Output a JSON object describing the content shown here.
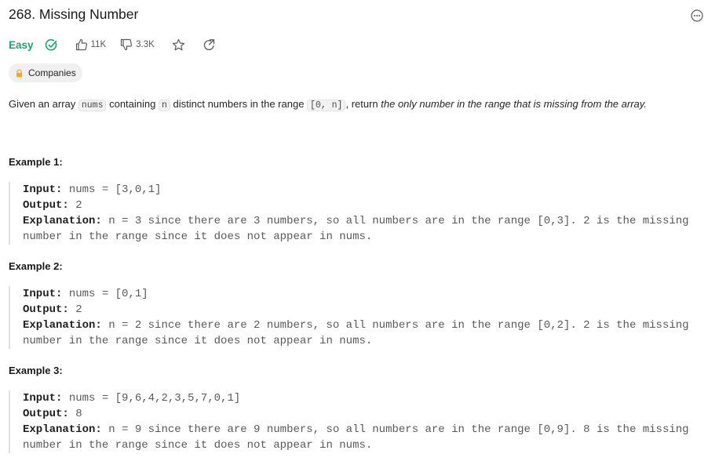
{
  "problem": {
    "title": "268. Missing Number",
    "difficulty": "Easy",
    "likes": "11K",
    "dislikes": "3.3K",
    "companies_label": "Companies"
  },
  "description": {
    "p1": "Given an array ",
    "c1": "nums",
    "p2": " containing ",
    "c2": "n",
    "p3": " distinct numbers in the range ",
    "c3": "[0, n]",
    "p4": ", return ",
    "em": "the only number in the range that is missing from the array."
  },
  "examples": [
    {
      "heading": "Example 1:",
      "input_label": "Input:",
      "input": " nums = [3,0,1]",
      "output_label": "Output:",
      "output": " 2",
      "explanation_label": "Explanation:",
      "explanation_1": " n = 3 since there are 3 numbers, so all numbers are in the range [0,3]. 2 is the missing",
      "explanation_2": "number in the range since it does not appear in nums."
    },
    {
      "heading": "Example 2:",
      "input_label": "Input:",
      "input": " nums = [0,1]",
      "output_label": "Output:",
      "output": " 2",
      "explanation_label": "Explanation:",
      "explanation_1": " n = 2 since there are 2 numbers, so all numbers are in the range [0,2]. 2 is the missing",
      "explanation_2": "number in the range since it does not appear in nums."
    },
    {
      "heading": "Example 3:",
      "input_label": "Input:",
      "input": " nums = [9,6,4,2,3,5,7,0,1]",
      "output_label": "Output:",
      "output": " 8",
      "explanation_label": "Explanation:",
      "explanation_1": " n = 9 since there are 9 numbers, so all numbers are in the range [0,9]. 8 is the missing",
      "explanation_2": "number in the range since it does not appear in nums."
    }
  ],
  "icons": {
    "solved": "check-circle-icon",
    "like": "thumbs-up-icon",
    "dislike": "thumbs-down-icon",
    "favorite": "star-icon",
    "share": "share-icon",
    "more": "more-icon",
    "lock": "lock-icon"
  },
  "colors": {
    "easy": "#1fa36b",
    "lock": "#f5a623"
  }
}
